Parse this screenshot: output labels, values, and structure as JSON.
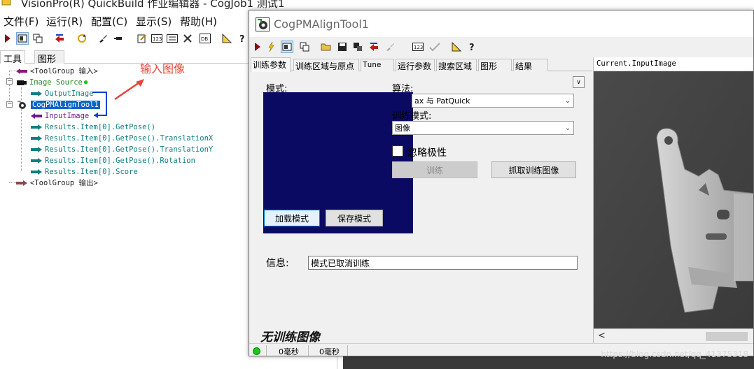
{
  "main_window": {
    "title": "VisionPro(R) QuickBuild 作业编辑器 - CogJob1 测试1",
    "menu": [
      "文件(F)",
      "运行(R)",
      "配置(C)",
      "显示(S)",
      "帮助(H)"
    ],
    "left_tabs": [
      "工具",
      "图形"
    ],
    "tree": {
      "toolgroup_input": "<ToolGroup 输入>",
      "image_source": "Image Source",
      "output_image": "OutputImage",
      "cog_pm_align_tool": "CogPMAlignTool1",
      "input_image": "InputImage",
      "results_getpose": "Results.Item[0].GetPose()",
      "results_translation_x": "Results.Item[0].GetPose().TranslationX",
      "results_translation_y": "Results.Item[0].GetPose().TranslationY",
      "results_rotation": "Results.Item[0].GetPose().Rotation",
      "results_score": "Results.Item[0].Score",
      "toolgroup_output": "<ToolGroup 输出>"
    },
    "annotation": "输入图像"
  },
  "dialog": {
    "title": "CogPMAlignTool1",
    "tabs": [
      "训练参数",
      "训练区域与原点",
      "Tune",
      "运行参数",
      "搜索区域",
      "图形",
      "结果"
    ],
    "pattern_label": "模式:",
    "algorithm_label": "算法:",
    "algorithm_value": "ax 与 PatQuick",
    "train_mode_label": "训练模式:",
    "train_mode_value": "图像",
    "ignore_polarity_label": "忽略极性",
    "train_button": "训练",
    "grab_train_image_button": "抓取训练图像",
    "load_pattern_button": "加载模式",
    "save_pattern_button": "保存模式",
    "info_label": "信息:",
    "info_value": "模式已取消训练",
    "no_train_image": "无训练图像",
    "image_panel_title": "Current.InputImage",
    "status": [
      "0毫秒",
      "0毫秒"
    ]
  },
  "watermark": "https://blog.csdn.net/qq_41375318",
  "colors": {
    "pattern_background": "#0a0a62",
    "selection": "#0a64c8",
    "annotation": "#e8443a",
    "status_ok": "#18c818"
  }
}
